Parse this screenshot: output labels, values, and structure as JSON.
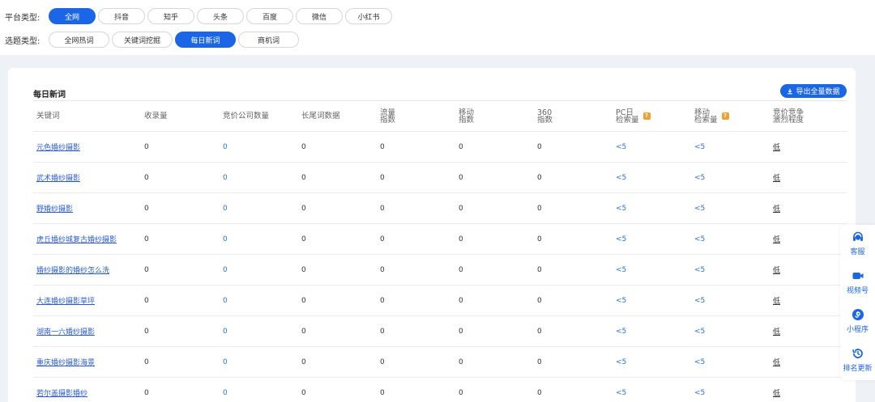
{
  "filters": {
    "platform": {
      "label": "平台类型:",
      "options": [
        "全网",
        "抖音",
        "知乎",
        "头条",
        "百度",
        "微信",
        "小红书"
      ],
      "active_index": 0
    },
    "topic": {
      "label": "选题类型:",
      "options": [
        "全网热词",
        "关键词挖掘",
        "每日新词",
        "商机词"
      ],
      "active_index": 2
    }
  },
  "card": {
    "title": "每日新词",
    "export_label": "导出全量数据"
  },
  "table": {
    "headers": [
      [
        "关键词"
      ],
      [
        "收录量"
      ],
      [
        "竞价公司数量"
      ],
      [
        "长尾词数据"
      ],
      [
        "流量",
        "指数"
      ],
      [
        "移动",
        "指数"
      ],
      [
        "360",
        "指数"
      ],
      [
        "PC日",
        "检索量"
      ],
      [
        "移动",
        "检索量"
      ],
      [
        "竞价竞争",
        "激烈程度"
      ]
    ],
    "rows": [
      [
        "元色婚纱摄影",
        "0",
        "0",
        "0",
        "0",
        "0",
        "0",
        "<5",
        "<5",
        "低"
      ],
      [
        "武术婚纱摄影",
        "0",
        "0",
        "0",
        "0",
        "0",
        "0",
        "<5",
        "<5",
        "低"
      ],
      [
        "野婚纱摄影",
        "0",
        "0",
        "0",
        "0",
        "0",
        "0",
        "<5",
        "<5",
        "低"
      ],
      [
        "虎丘婚纱城复古婚纱摄影",
        "0",
        "0",
        "0",
        "0",
        "0",
        "0",
        "<5",
        "<5",
        "低"
      ],
      [
        "婚纱摄影的婚纱怎么洗",
        "0",
        "0",
        "0",
        "0",
        "0",
        "0",
        "<5",
        "<5",
        "低"
      ],
      [
        "大连婚纱摄影草坪",
        "0",
        "0",
        "0",
        "0",
        "0",
        "0",
        "<5",
        "<5",
        "低"
      ],
      [
        "湖南一六婚纱摄影",
        "0",
        "0",
        "0",
        "0",
        "0",
        "0",
        "<5",
        "<5",
        "低"
      ],
      [
        "重庆婚纱摄影海景",
        "0",
        "0",
        "0",
        "0",
        "0",
        "0",
        "<5",
        "<5",
        "低"
      ],
      [
        "若尔盖摄影婚纱",
        "0",
        "0",
        "0",
        "0",
        "0",
        "0",
        "<5",
        "<5",
        "低"
      ]
    ]
  },
  "float_bar": {
    "items": [
      {
        "label": "客服",
        "icon": "headset-icon"
      },
      {
        "label": "视频号",
        "icon": "video-camera-icon"
      },
      {
        "label": "小程序",
        "icon": "mini-program-icon"
      },
      {
        "label": "排名更新",
        "icon": "history-icon"
      }
    ]
  },
  "colors": {
    "accent": "#1a66e6",
    "link": "#2a5bd7",
    "tip": "#f0a030"
  }
}
